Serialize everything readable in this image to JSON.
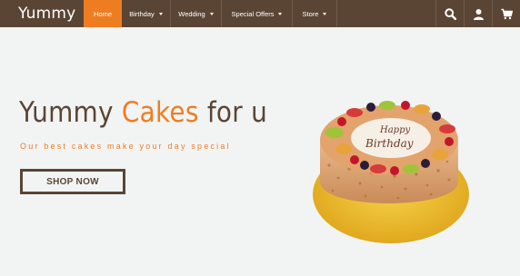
{
  "brand": {
    "logo_text": "Yummy"
  },
  "nav": {
    "items": [
      {
        "label": "Home",
        "active": true,
        "dropdown": false
      },
      {
        "label": "Birthday",
        "active": false,
        "dropdown": true
      },
      {
        "label": "Wedding",
        "active": false,
        "dropdown": true
      },
      {
        "label": "Special Offers",
        "active": false,
        "dropdown": true
      },
      {
        "label": "Store",
        "active": false,
        "dropdown": true
      }
    ],
    "icons": [
      "search-icon",
      "user-icon",
      "cart-icon"
    ]
  },
  "hero": {
    "title_part1": "Yummy ",
    "title_accent": "Cakes",
    "title_part2": " for u",
    "subtitle": "Our best cakes make your day special",
    "cta_label": "SHOP NOW",
    "cake_text_line1": "Happy",
    "cake_text_line2": "Birthday"
  },
  "colors": {
    "nav_bg": "#5a4535",
    "accent": "#ee7d22",
    "page_bg": "#f2f4f4"
  }
}
